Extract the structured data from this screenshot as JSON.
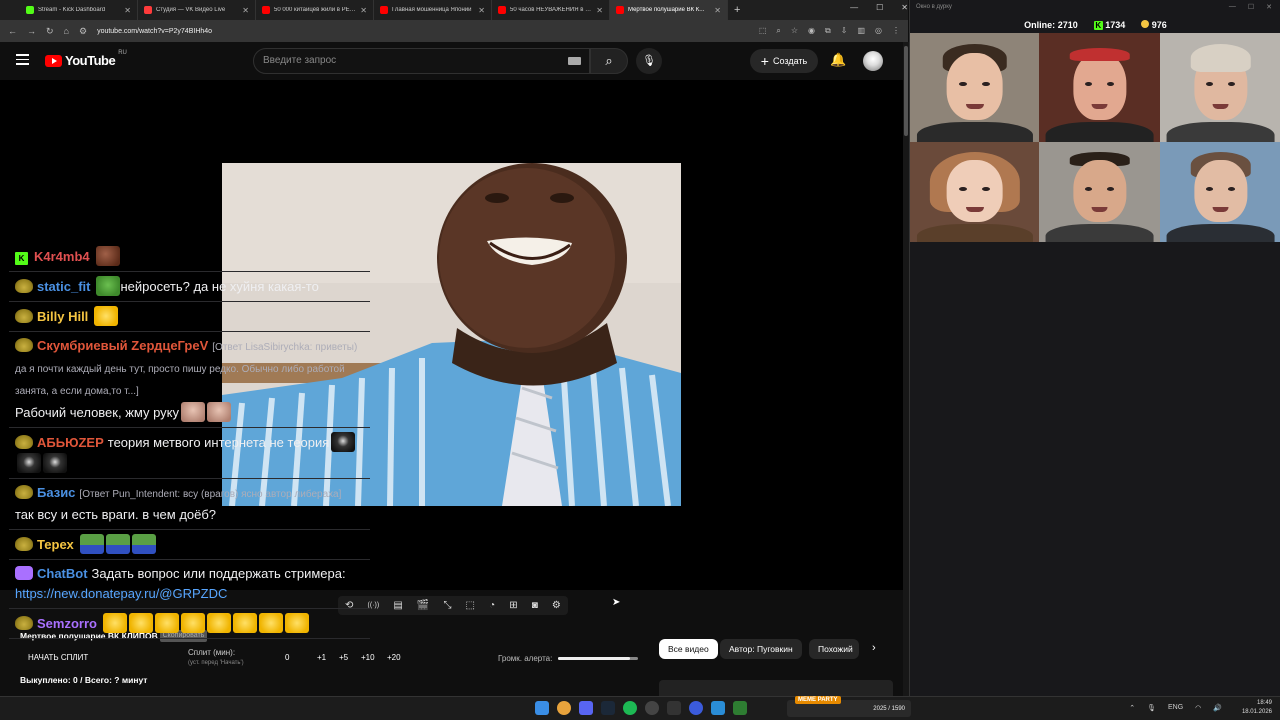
{
  "browser": {
    "tabs": [
      {
        "title": "Stream - Kick Dashboard",
        "color": "#53fc18"
      },
      {
        "title": "Студия — VK Видео Live",
        "color": "#ff3b3b"
      },
      {
        "title": "50 000 китайцев жили в РЕАЛЬ...",
        "color": "#ff0000"
      },
      {
        "title": "Главная мошенница Японии",
        "color": "#ff0000"
      },
      {
        "title": "50 часов НЕУВАЖЕНИЯ в SAN...",
        "color": "#ff0000"
      },
      {
        "title": "Мертвое полушарие ВК К...",
        "color": "#ff0000"
      }
    ],
    "new_tab": "+",
    "url": "youtube.com/watch?v=P2y74BIHh4o"
  },
  "youtube": {
    "logo_text": "YouTube",
    "region": "RU",
    "search_placeholder": "Введите запрос",
    "create_label": "Создать"
  },
  "player_controls": [
    "repeat-icon",
    "broadcast-icon",
    "watch-later-icon",
    "clapper-icon",
    "resize-icon",
    "cut-icon",
    "speed-icon",
    "add-icon",
    "camera-icon",
    "gear-icon"
  ],
  "panel": {
    "video_title": "Мертвое полушарие ВК КЛИПОВ",
    "badge": "Скопировать",
    "start_split": "НАЧАТЬ СПЛИТ",
    "split_label": "Сплит (мин):",
    "split_hint": "(уст. перед 'Начать')",
    "split_value": "0",
    "increments": [
      "+1",
      "+5",
      "+10",
      "+20"
    ],
    "alert_label": "Громк. алерта:",
    "alert_level": 0.9,
    "progress": "Выкуплено: 0 / Всего: ? минут",
    "chips": [
      {
        "label": "Все видео",
        "selected": true
      },
      {
        "label": "Автор: Пуговкин",
        "selected": false
      },
      {
        "label": "Похожий",
        "selected": false
      }
    ],
    "chip_next": "›"
  },
  "overlay": {
    "window_title": "Окно в дурку",
    "online_label": "Online:",
    "online_value": "2710",
    "kick_count": "1734",
    "coin_count": "976"
  },
  "chat": [
    {
      "user": "K4r4mb4",
      "color": "#e05050",
      "badge": "kick",
      "text": "",
      "reply": "",
      "emotes": [
        "e-drake"
      ]
    },
    {
      "user": "static_fit",
      "color": "#4a90e2",
      "badge": "pepe",
      "text": "нейросеть? да не хуйня какая-то",
      "reply": "",
      "emotes": [
        "e-frog"
      ],
      "emote_first": true
    },
    {
      "user": "Billy Hill",
      "color": "#f5c542",
      "badge": "pepe",
      "text": "",
      "reply": "",
      "emotes": [
        "e-laugh"
      ]
    },
    {
      "user": "Скумбриевый ZердцеГреV",
      "color": "#e0563a",
      "badge": "pepe",
      "reply": "[Ответ LisaSibirychka: приветы) да я почти каждый день тут, просто пишу редко. Обычно либо работой занята, а если дома,то т...]",
      "text": "Рабочий человек, жму руку",
      "emotes": [
        "e-face",
        "e-face"
      ]
    },
    {
      "user": "АБЬЮZЕР",
      "color": "#e0563a",
      "badge": "pepe",
      "reply": "",
      "text": "теория метвого интернета не теория",
      "emotes": [
        "e-cat",
        "e-cat",
        "e-cat"
      ]
    },
    {
      "user": "Базис",
      "color": "#4a90e2",
      "badge": "pepe",
      "reply": "[Ответ Pun_Intendent: всу (врагов) ясно автор либераха]",
      "text": "так всу и есть враги. в чем доёб?",
      "emotes": []
    },
    {
      "user": "Терех",
      "color": "#f5c542",
      "badge": "pepe",
      "reply": "",
      "text": "",
      "emotes": [
        "e-pepe-blue",
        "e-pepe-blue",
        "e-pepe-blue"
      ]
    },
    {
      "user": "ChatBot",
      "color": "#4a90e2",
      "badge": "bot",
      "reply": "",
      "text": "Задать вопрос или поддержать стримера:",
      "link": "https://new.donatepay.ru/@GRPZDC",
      "emotes": []
    },
    {
      "user": "Semzorro",
      "color": "#a970ff",
      "badge": "pepe",
      "reply": "",
      "text": "",
      "emotes": [
        "e-laugh",
        "e-laugh",
        "e-laugh",
        "e-laugh",
        "e-laugh",
        "e-laugh",
        "e-laugh",
        "e-laugh"
      ]
    }
  ],
  "taskbar": {
    "widget_title": "MEME PARTY",
    "widget_counter": "2025 / 1590",
    "lang": "ENG",
    "time": "18:49",
    "date": "18.01.2026"
  },
  "colors": {
    "youtube_red": "#ff0000",
    "kick_green": "#53fc18",
    "chat_bg": "#18181b"
  }
}
